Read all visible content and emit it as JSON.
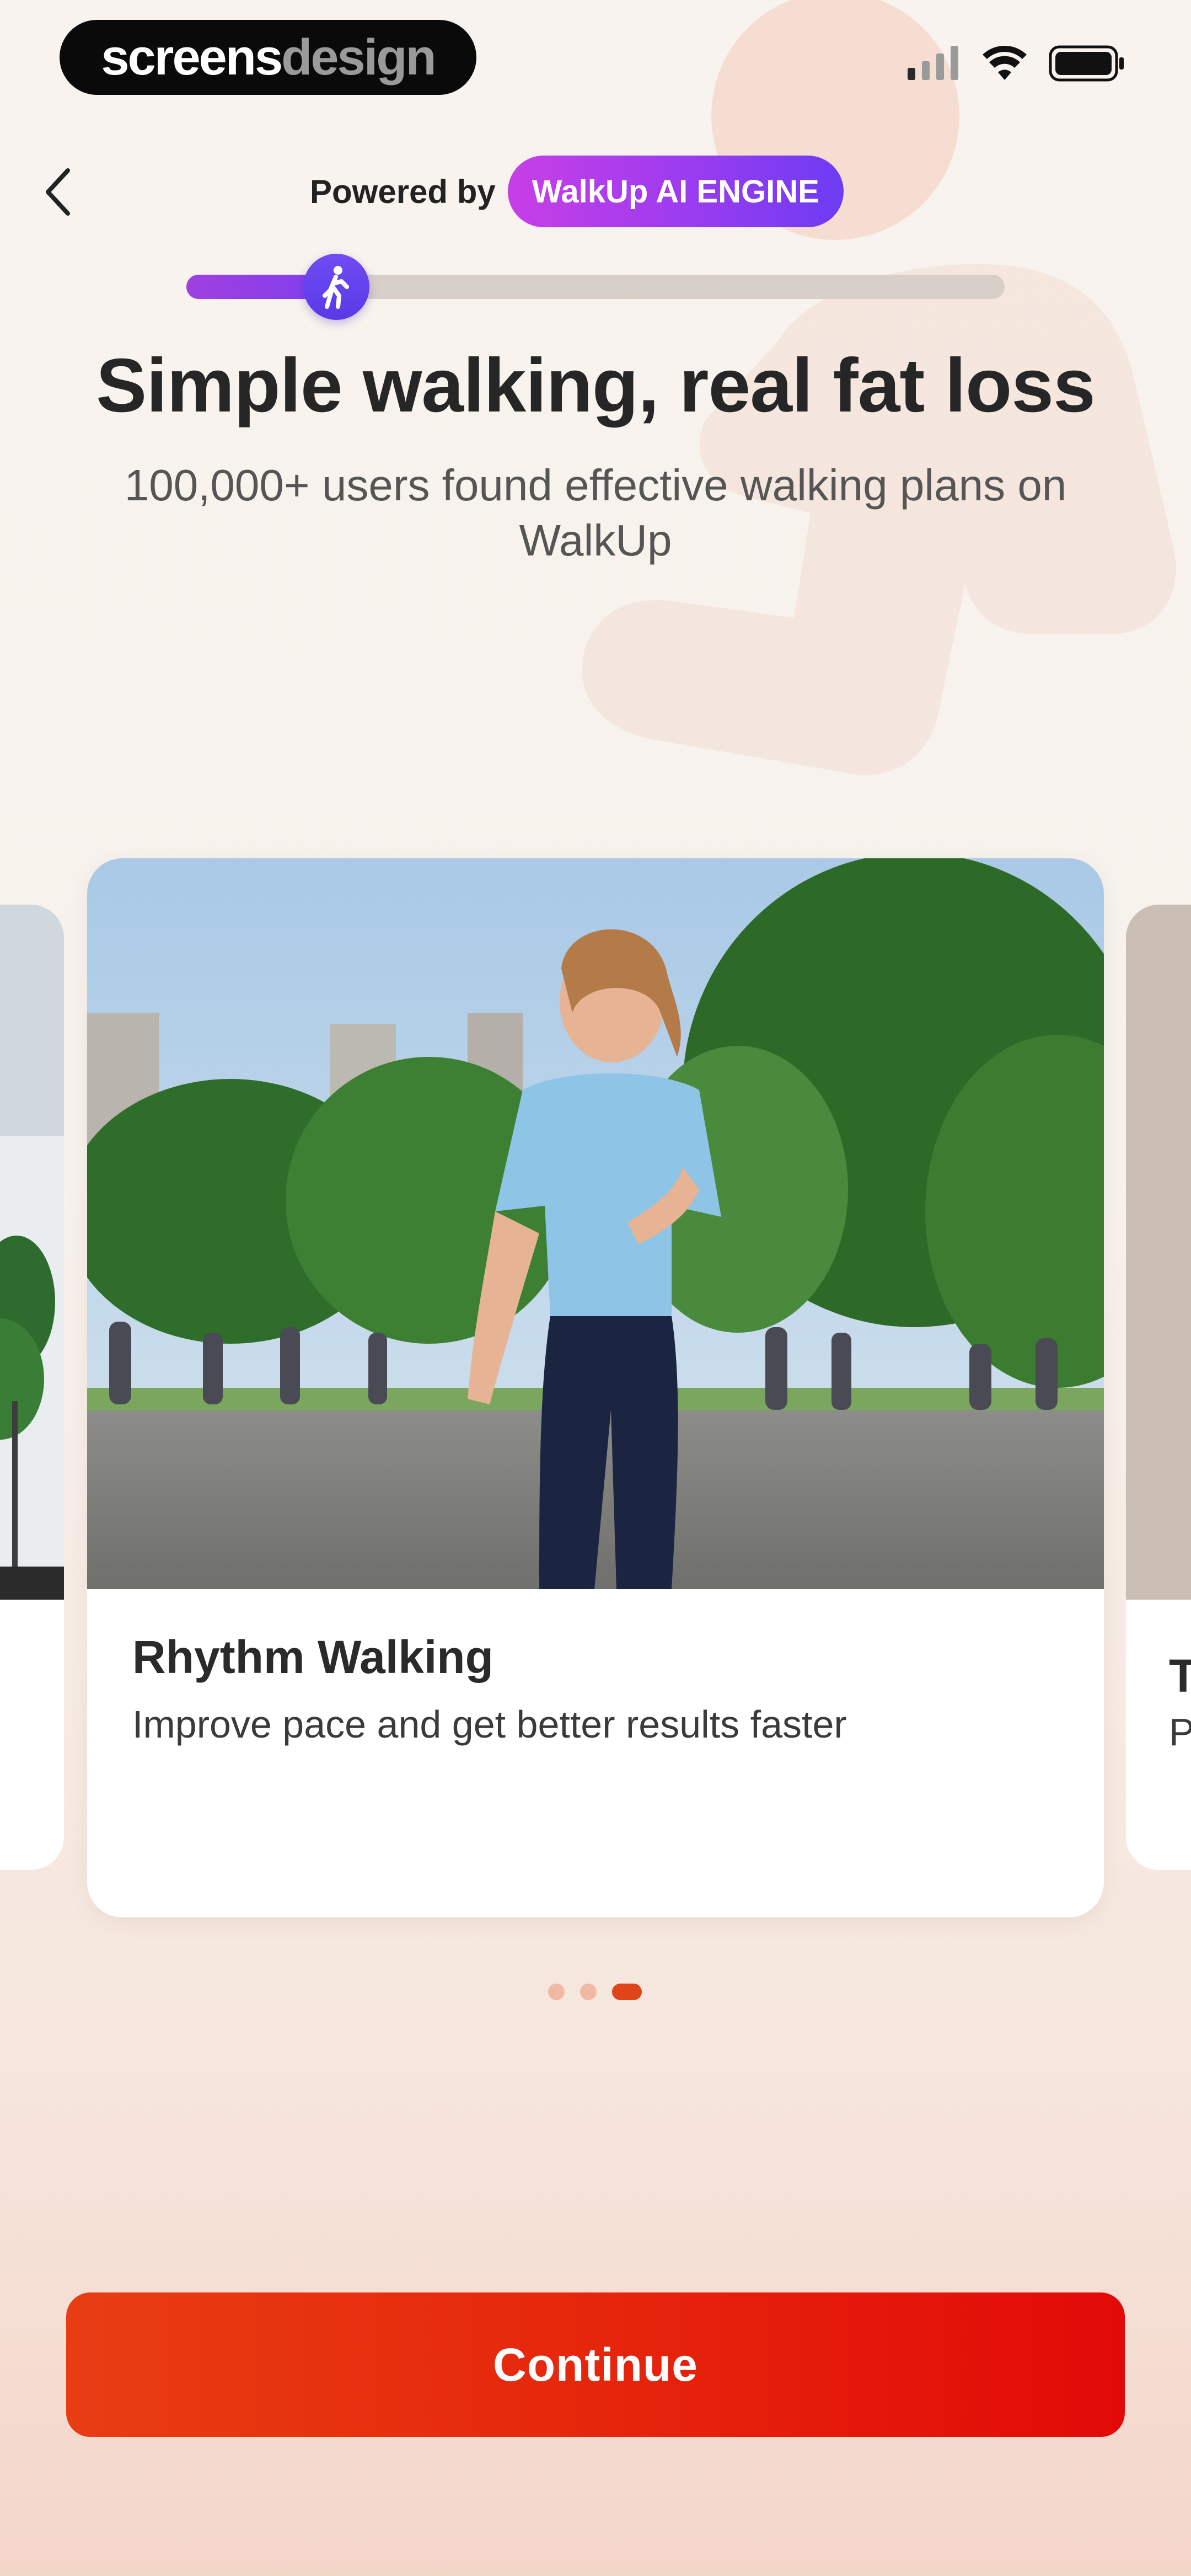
{
  "watermark": {
    "part1": "screens",
    "part2": "design"
  },
  "status_bar": {
    "signal_icon": "cellular-signal-icon",
    "wifi_icon": "wifi-icon",
    "battery_icon": "battery-icon"
  },
  "header": {
    "back_icon": "chevron-left-icon",
    "powered_by_label": "Powered by",
    "engine_badge": "WalkUp AI ENGINE",
    "badge_gradient": [
      "#c83ee6",
      "#6d3cf2"
    ]
  },
  "progress": {
    "value": 0.2,
    "knob_icon": "walking-person-icon"
  },
  "title": "Simple walking, real fat loss",
  "subtitle": "100,000+ users found effective walking plans on WalkUp",
  "carousel": {
    "current_card": {
      "title": "Rhythm Walking",
      "description": "Improve pace and get better results faster",
      "image": "woman-power-walking-in-park-photo"
    },
    "next_card_peek": {
      "title": "T",
      "description": "P"
    },
    "page_count": 3,
    "active_index": 2
  },
  "cta": {
    "label": "Continue",
    "color": "#e6260c"
  },
  "colors": {
    "accent": "#e0451a",
    "purple": "#7a3ef0",
    "background": "#f8f3ee"
  }
}
